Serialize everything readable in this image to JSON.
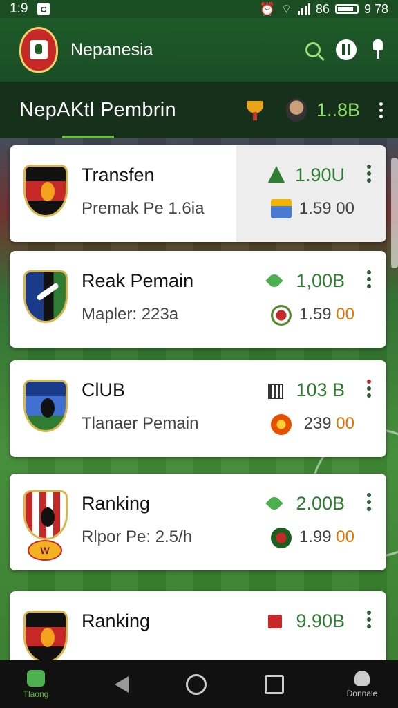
{
  "status_bar": {
    "time": "1:9",
    "signal": "86",
    "clock_right": "9 78"
  },
  "app_bar": {
    "title": "Nepanesia"
  },
  "tab_header": {
    "title": "NepAKtl Pembrin",
    "balance": "1..8B"
  },
  "cards": [
    {
      "title": "Transfen",
      "subtitle": "Premak Pe 1.6ia",
      "value_primary": "1.90U",
      "value_secondary": "1.59 00",
      "value_secondary_main": "1.59",
      "value_secondary_suffix": "00"
    },
    {
      "title": "Reak Pemain",
      "subtitle": "Mapler: 223a",
      "value_primary": "1,00B",
      "value_secondary_main": "1.59",
      "value_secondary_suffix": "00"
    },
    {
      "title": "ClUB",
      "subtitle": "Tlanaer Pemain",
      "value_primary": "103 B",
      "value_secondary_main": "239",
      "value_secondary_suffix": "00"
    },
    {
      "title": "Ranking",
      "subtitle": "Rlpor Pe: 2.5/h",
      "value_primary": "2.00B",
      "value_secondary_main": "1.99",
      "value_secondary_suffix": "00",
      "badge": "W"
    },
    {
      "title": "Ranking",
      "subtitle": "",
      "value_primary": "9.90B",
      "value_secondary_main": "",
      "value_secondary_suffix": ""
    }
  ],
  "nav_bar": {
    "home_label": "Tlaong",
    "profile_label": "Donnale"
  },
  "colors": {
    "primary_green": "#1b4d23",
    "accent_green": "#66bb45",
    "value_green": "#2e7d32",
    "suffix_orange": "#e57300"
  }
}
